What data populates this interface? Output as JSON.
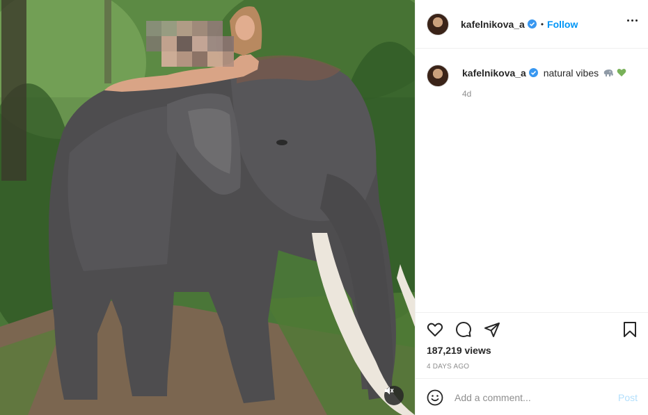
{
  "post": {
    "username": "kafelnikova_a",
    "verified": true,
    "separator": "•",
    "follow_label": "Follow",
    "more_icon": "more-horizontal-icon"
  },
  "caption": {
    "username": "kafelnikova_a",
    "text": "natural vibes",
    "emojis": [
      "elephant-emoji",
      "green-heart-emoji"
    ],
    "time": "4d"
  },
  "stats": {
    "views": "187,219 views",
    "date": "4 DAYS AGO"
  },
  "comment": {
    "placeholder": "Add a comment...",
    "post_label": "Post"
  },
  "colors": {
    "link_blue": "#0095f6",
    "post_disabled": "#b2dffc",
    "muted_text": "#8e8e8e",
    "border": "#efefef"
  },
  "icons": {
    "like": "heart-icon",
    "comment": "comment-icon",
    "share": "share-icon",
    "save": "bookmark-icon",
    "emoji": "smile-icon",
    "mute": "speaker-muted-icon"
  }
}
